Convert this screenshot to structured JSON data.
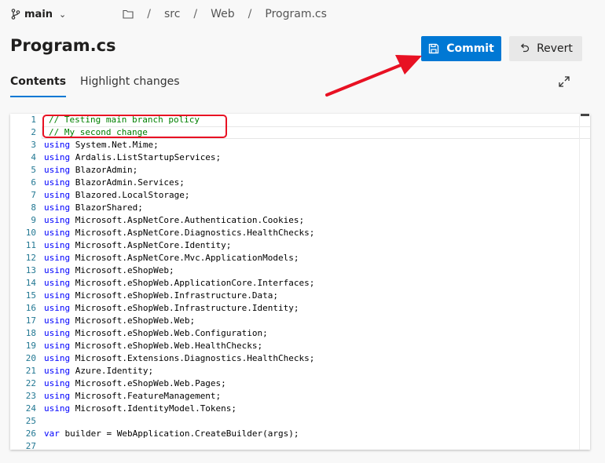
{
  "branch": {
    "name": "main"
  },
  "breadcrumb": [
    "src",
    "Web",
    "Program.cs"
  ],
  "title": "Program.cs",
  "buttons": {
    "commit": "Commit",
    "revert": "Revert"
  },
  "tabs": [
    {
      "label": "Contents",
      "active": true
    },
    {
      "label": "Highlight changes",
      "active": false
    }
  ],
  "colors": {
    "accent": "#0078d4",
    "annotation": "#e81123",
    "keyword": "#0000ff",
    "comment": "#008000",
    "line_number": "#237893"
  },
  "editor": {
    "lines": [
      {
        "n": "1",
        "kind": "comment",
        "text": "// Testing main branch policy"
      },
      {
        "n": "2",
        "kind": "comment",
        "text": "// My second change"
      },
      {
        "n": "3",
        "kind": "using",
        "kw": "using",
        "text": " System.Net.Mime;"
      },
      {
        "n": "4",
        "kind": "using",
        "kw": "using",
        "text": " Ardalis.ListStartupServices;"
      },
      {
        "n": "5",
        "kind": "using",
        "kw": "using",
        "text": " BlazorAdmin;"
      },
      {
        "n": "6",
        "kind": "using",
        "kw": "using",
        "text": " BlazorAdmin.Services;"
      },
      {
        "n": "7",
        "kind": "using",
        "kw": "using",
        "text": " Blazored.LocalStorage;"
      },
      {
        "n": "8",
        "kind": "using",
        "kw": "using",
        "text": " BlazorShared;"
      },
      {
        "n": "9",
        "kind": "using",
        "kw": "using",
        "text": " Microsoft.AspNetCore.Authentication.Cookies;"
      },
      {
        "n": "10",
        "kind": "using",
        "kw": "using",
        "text": " Microsoft.AspNetCore.Diagnostics.HealthChecks;"
      },
      {
        "n": "11",
        "kind": "using",
        "kw": "using",
        "text": " Microsoft.AspNetCore.Identity;"
      },
      {
        "n": "12",
        "kind": "using",
        "kw": "using",
        "text": " Microsoft.AspNetCore.Mvc.ApplicationModels;"
      },
      {
        "n": "13",
        "kind": "using",
        "kw": "using",
        "text": " Microsoft.eShopWeb;"
      },
      {
        "n": "14",
        "kind": "using",
        "kw": "using",
        "text": " Microsoft.eShopWeb.ApplicationCore.Interfaces;"
      },
      {
        "n": "15",
        "kind": "using",
        "kw": "using",
        "text": " Microsoft.eShopWeb.Infrastructure.Data;"
      },
      {
        "n": "16",
        "kind": "using",
        "kw": "using",
        "text": " Microsoft.eShopWeb.Infrastructure.Identity;"
      },
      {
        "n": "17",
        "kind": "using",
        "kw": "using",
        "text": " Microsoft.eShopWeb.Web;"
      },
      {
        "n": "18",
        "kind": "using",
        "kw": "using",
        "text": " Microsoft.eShopWeb.Web.Configuration;"
      },
      {
        "n": "19",
        "kind": "using",
        "kw": "using",
        "text": " Microsoft.eShopWeb.Web.HealthChecks;"
      },
      {
        "n": "20",
        "kind": "using",
        "kw": "using",
        "text": " Microsoft.Extensions.Diagnostics.HealthChecks;"
      },
      {
        "n": "21",
        "kind": "using",
        "kw": "using",
        "text": " Azure.Identity;"
      },
      {
        "n": "22",
        "kind": "using",
        "kw": "using",
        "text": " Microsoft.eShopWeb.Web.Pages;"
      },
      {
        "n": "23",
        "kind": "using",
        "kw": "using",
        "text": " Microsoft.FeatureManagement;"
      },
      {
        "n": "24",
        "kind": "using",
        "kw": "using",
        "text": " Microsoft.IdentityModel.Tokens;"
      },
      {
        "n": "25",
        "kind": "blank",
        "text": ""
      },
      {
        "n": "26",
        "kind": "using",
        "kw": "var",
        "text": " builder = WebApplication.CreateBuilder(args);"
      },
      {
        "n": "27",
        "kind": "blank",
        "text": ""
      }
    ]
  }
}
